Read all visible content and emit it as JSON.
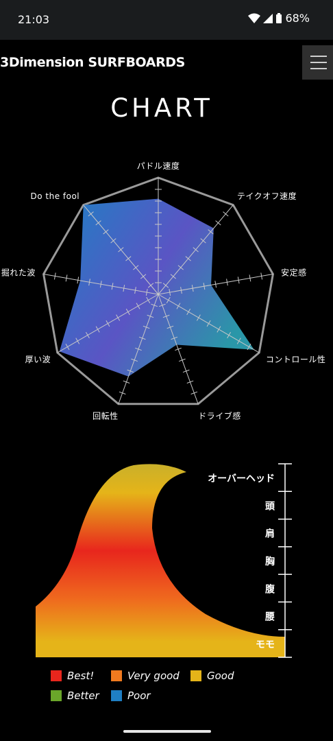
{
  "status": {
    "time": "21:03",
    "battery": "68%"
  },
  "header": {
    "logo": "3Dimension SURFBOARDS",
    "menu_icon": "hamburger-icon"
  },
  "page": {
    "title": "CHART"
  },
  "chart_data": [
    {
      "type": "radar",
      "axes": [
        "パドル速度",
        "テイクオフ速度",
        "安定感",
        "コントロール性",
        "ドライブ感",
        "回転性",
        "厚い波",
        "掘れた波",
        "Do the fool"
      ],
      "max": 10,
      "values": [
        8.2,
        7.4,
        4.6,
        9.5,
        4.6,
        7.5,
        9.8,
        6.8,
        10
      ],
      "colors": [
        "#1f7fc4",
        "#5a55c4",
        "#2a97a8"
      ]
    },
    {
      "type": "area",
      "y_categories": [
        "オーバーヘッド",
        "頭",
        "肩",
        "胸",
        "腹",
        "腰",
        "モモ"
      ],
      "legend": [
        {
          "label": "Best!",
          "color": "#e8261d"
        },
        {
          "label": "Very good",
          "color": "#f07a1f"
        },
        {
          "label": "Good",
          "color": "#e5b419"
        },
        {
          "label": "Better",
          "color": "#6aa62a"
        },
        {
          "label": "Poor",
          "color": "#1f7fc4"
        }
      ]
    }
  ]
}
